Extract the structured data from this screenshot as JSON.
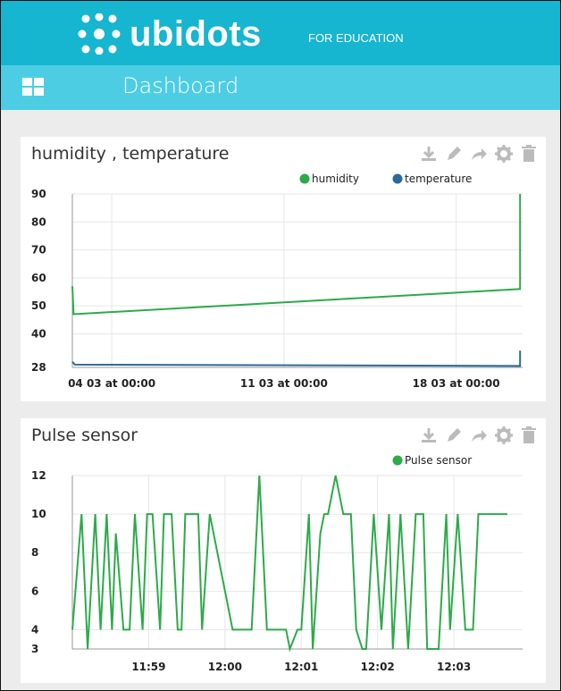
{
  "brand": {
    "name": "ubidots",
    "tagline": "FOR EDUCATION",
    "color": "#16b5d0"
  },
  "subbar": {
    "title": "Dashboard",
    "color": "#4dcde3"
  },
  "cards": [
    {
      "title": "humidity , temperature",
      "tools": [
        "download-icon",
        "edit-icon",
        "share-icon",
        "settings-icon",
        "delete-icon"
      ]
    },
    {
      "title": "Pulse sensor",
      "tools": [
        "download-icon",
        "edit-icon",
        "share-icon",
        "settings-icon",
        "delete-icon"
      ]
    }
  ],
  "chart_data": [
    {
      "type": "line",
      "title": "humidity , temperature",
      "ylim": [
        28,
        90
      ],
      "yticks": [
        "90",
        "80",
        "70",
        "60",
        "50",
        "40",
        "28"
      ],
      "ytick_values": [
        90,
        80,
        70,
        60,
        50,
        40,
        28
      ],
      "xticks": [
        "04 03 at 00:00",
        "11 03 at 00:00",
        "18 03 at 00:00"
      ],
      "xtick_values": [
        2.5,
        9.5,
        16.5
      ],
      "xlim": [
        0.9,
        19.2
      ],
      "grid": true,
      "legend_position": "top-right",
      "series": [
        {
          "name": "humidity",
          "color": "#2daa4a",
          "x": [
            0.9,
            0.95,
            19.05,
            19.1,
            19.1
          ],
          "y": [
            57,
            47,
            56,
            56,
            90
          ]
        },
        {
          "name": "temperature",
          "color": "#2d6a96",
          "x": [
            0.9,
            1.0,
            19.05,
            19.1,
            19.1
          ],
          "y": [
            30,
            29,
            28.5,
            28.5,
            34
          ]
        }
      ]
    },
    {
      "type": "line",
      "title": "Pulse sensor",
      "ylim": [
        3,
        12
      ],
      "yticks": [
        "12",
        "10",
        "8",
        "6",
        "4",
        "3"
      ],
      "ytick_values": [
        12,
        10,
        8,
        6,
        4,
        3
      ],
      "xticks": [
        "11:59",
        "12:00",
        "12:01",
        "12:02",
        "12:03"
      ],
      "xtick_values": [
        1,
        2,
        3,
        4,
        5
      ],
      "xlim": [
        0,
        5.9
      ],
      "grid": true,
      "legend_position": "top-right",
      "series": [
        {
          "name": "Pulse sensor",
          "color": "#2daa4a",
          "x": [
            0,
            0.12,
            0.2,
            0.3,
            0.37,
            0.45,
            0.52,
            0.57,
            0.67,
            0.75,
            0.82,
            0.92,
            0.98,
            1.05,
            1.15,
            1.2,
            1.3,
            1.38,
            1.43,
            1.48,
            1.55,
            1.65,
            1.7,
            1.8,
            2.1,
            2.2,
            2.35,
            2.45,
            2.55,
            2.8,
            2.85,
            2.95,
            3.0,
            3.1,
            3.15,
            3.25,
            3.3,
            3.35,
            3.45,
            3.55,
            3.65,
            3.72,
            3.8,
            3.85,
            3.95,
            4.05,
            4.15,
            4.2,
            4.3,
            4.4,
            4.5,
            4.6,
            4.65,
            4.8,
            4.9,
            4.95,
            5.05,
            5.15,
            5.25,
            5.32,
            5.4,
            5.5,
            5.6,
            5.7
          ],
          "y": [
            4,
            10,
            3,
            10,
            4,
            10,
            4,
            9,
            4,
            4,
            10,
            4,
            10,
            10,
            4,
            10,
            10,
            4,
            4,
            10,
            10,
            10,
            4,
            10,
            4,
            4,
            4,
            12,
            4,
            4,
            3,
            4,
            4,
            10,
            3,
            9,
            10,
            10,
            12,
            10,
            10,
            4,
            3,
            3,
            10,
            4,
            10,
            3,
            10,
            3,
            10,
            10,
            3,
            3,
            10,
            4,
            10,
            4,
            4,
            10,
            10,
            10,
            10,
            10
          ]
        }
      ]
    }
  ]
}
